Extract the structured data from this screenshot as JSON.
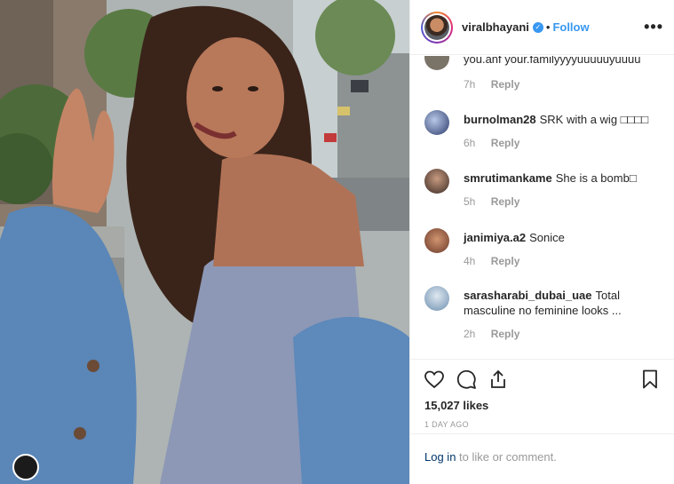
{
  "post": {
    "username": "viralbhayani",
    "verified_mark": "✓",
    "separator": "•",
    "follow_label": "Follow",
    "more_label": "•••"
  },
  "comments": [
    {
      "user": "",
      "text": "you.anf your.familyyyyuuuuuyuuuu",
      "time": "7h",
      "reply": "Reply"
    },
    {
      "user": "burnolman28",
      "text": "SRK with a wig □□□□",
      "time": "6h",
      "reply": "Reply"
    },
    {
      "user": "smrutimankame",
      "text": "She is a bomb□",
      "time": "5h",
      "reply": "Reply"
    },
    {
      "user": "janimiya.a2",
      "text": "Sonice",
      "time": "4h",
      "reply": "Reply"
    },
    {
      "user": "sarasharabi_dubai_uae",
      "text": "Total masculine no feminine looks ...",
      "time": "2h",
      "reply": "Reply"
    }
  ],
  "likes": "15,027 likes",
  "posted_ago": "1 DAY AGO",
  "login": {
    "link": "Log in",
    "rest": " to like or comment."
  },
  "icons": [
    "heart-icon",
    "comment-icon",
    "share-icon",
    "bookmark-icon",
    "verified-badge-icon",
    "more-options-icon"
  ],
  "colors": {
    "accent": "#3897f0",
    "link": "#003569",
    "muted": "#999999",
    "text": "#262626"
  }
}
